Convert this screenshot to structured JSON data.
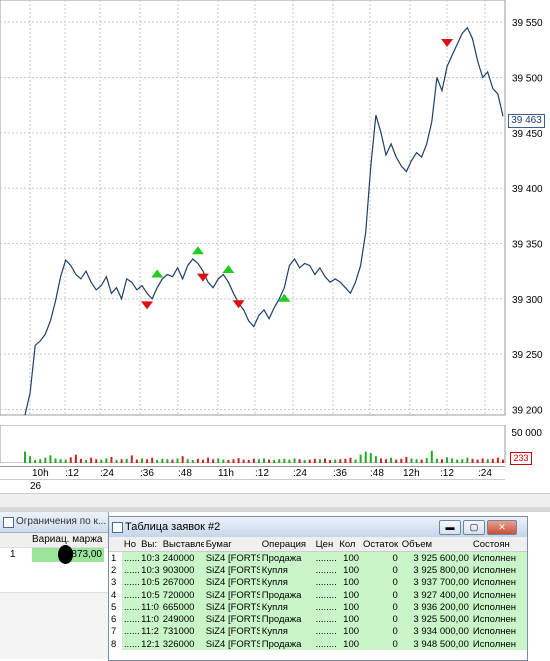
{
  "price_axis": {
    "ticks": [
      "39 550",
      "39 500",
      "39 450",
      "39 400",
      "39 350",
      "39 300",
      "39 250",
      "39 200"
    ],
    "tick_values": [
      39550,
      39500,
      39450,
      39400,
      39350,
      39300,
      39250,
      39200
    ],
    "last_price": "39 463"
  },
  "volume_axis": {
    "tick": "50 000",
    "last_volume": "233"
  },
  "time_axis": {
    "labels": [
      "10h",
      ":12",
      ":24",
      ":36",
      ":48",
      "11h",
      ":12",
      ":24",
      ":36",
      ":48",
      "12h",
      ":12",
      ":24"
    ],
    "date": "26"
  },
  "colors": {
    "price_line": "#1f3f6a",
    "buy_marker": "#22cc22",
    "sell_marker": "#dd1111",
    "volume_up": "#22aa22",
    "volume_down": "#cc2222",
    "grid": "#c8c8c8",
    "row_fill": "#c9f5c9"
  },
  "chart_data": {
    "type": "line",
    "ylim": [
      39195,
      39570
    ],
    "series": [
      {
        "values": [
          39195,
          39215,
          39258,
          39262,
          39268,
          39280,
          39298,
          39320,
          39335,
          39330,
          39322,
          39318,
          39325,
          39315,
          39308,
          39312,
          39320,
          39305,
          39310,
          39300,
          39318,
          39315,
          39308,
          39312,
          39305,
          39300,
          39310,
          39318,
          39322,
          39320,
          39328,
          39318,
          39330,
          39336,
          39332,
          39325,
          39315,
          39310,
          39318,
          39322,
          39315,
          39305,
          39296,
          39290,
          39280,
          39275,
          39285,
          39290,
          39282,
          39292,
          39300,
          39310,
          39330,
          39336,
          39328,
          39332,
          39330,
          39322,
          39328,
          39320,
          39315,
          39318,
          39315,
          39310,
          39305,
          39315,
          39330,
          39360,
          39420,
          39466,
          39450,
          39430,
          39440,
          39428,
          39420,
          39415,
          39425,
          39432,
          39428,
          39440,
          39460,
          39500,
          39488,
          39510,
          39520,
          39530,
          39540,
          39545,
          39535,
          39515,
          39500,
          39505,
          39490,
          39485,
          39465
        ]
      }
    ],
    "markers": [
      {
        "type": "sell",
        "index": 24,
        "value": 39295
      },
      {
        "type": "buy",
        "index": 26,
        "value": 39322
      },
      {
        "type": "buy",
        "index": 34,
        "value": 39343
      },
      {
        "type": "sell",
        "index": 35,
        "value": 39320
      },
      {
        "type": "buy",
        "index": 40,
        "value": 39326
      },
      {
        "type": "sell",
        "index": 42,
        "value": 39296
      },
      {
        "type": "buy",
        "index": 51,
        "value": 39300
      },
      {
        "type": "sell",
        "index": 83,
        "value": 39532
      }
    ],
    "volume": [
      30,
      18,
      8,
      10,
      14,
      20,
      12,
      10,
      9,
      15,
      22,
      11,
      8,
      14,
      10,
      9,
      12,
      16,
      8,
      10,
      11,
      20,
      9,
      12,
      10,
      14,
      8,
      11,
      10,
      9,
      12,
      18,
      10,
      8,
      11,
      9,
      14,
      10,
      12,
      9,
      8,
      10,
      13,
      9,
      8,
      11,
      10,
      12,
      9,
      8,
      10,
      11,
      9,
      12,
      10,
      8,
      9,
      11,
      10,
      12,
      8,
      9,
      10,
      11,
      14,
      9,
      22,
      30,
      26,
      18,
      12,
      10,
      14,
      9,
      11,
      16,
      12,
      10,
      9,
      13,
      32,
      11,
      10,
      15,
      12,
      9,
      10,
      14,
      11,
      9,
      12,
      10,
      11,
      14,
      9
    ],
    "volume_ylim": [
      0,
      60000
    ]
  },
  "limits_panel": {
    "title": "Ограничения по к...",
    "header": "Вариац. маржа",
    "row_index": "1",
    "value": "873,00"
  },
  "orders_window": {
    "title": "Таблица заявок #2",
    "buttons": {
      "minimize": "▬",
      "maximize": "▢",
      "close": "✕"
    },
    "columns": [
      "",
      "Но",
      "Вы:",
      "Выставлен",
      "Бумаг",
      "Операция",
      "Цен",
      "Кол",
      "Остаток",
      "Объем",
      "Состоян"
    ],
    "rows": [
      [
        "1",
        "......",
        "10:3",
        "240000",
        "SiZ4 [FORTS]",
        "Продажа",
        "........",
        "100",
        "0",
        "3 925 600,00",
        "Исполнен"
      ],
      [
        "2",
        "......",
        "10:3",
        "903000",
        "SiZ4 [FORTS]",
        "Купля",
        "........",
        "100",
        "0",
        "3 925 800,00",
        "Исполнен"
      ],
      [
        "3",
        "......",
        "10:5",
        "267000",
        "SiZ4 [FORTS]",
        "Купля",
        "........",
        "100",
        "0",
        "3 937 700,00",
        "Исполнен"
      ],
      [
        "4",
        "......",
        "10:5",
        "720000",
        "SiZ4 [FORTS]",
        "Продажа",
        "........",
        "100",
        "0",
        "3 927 400,00",
        "Исполнен"
      ],
      [
        "5",
        "......",
        "11:0",
        "665000",
        "SiZ4 [FORTS]",
        "Купля",
        "........",
        "100",
        "0",
        "3 936 200,00",
        "Исполнен"
      ],
      [
        "6",
        "......",
        "11:0",
        "249000",
        "SiZ4 [FORTS]",
        "Продажа",
        "........",
        "100",
        "0",
        "3 925 500,00",
        "Исполнен"
      ],
      [
        "7",
        "......",
        "11:2",
        "731000",
        "SiZ4 [FORTS]",
        "Купля",
        "........",
        "100",
        "0",
        "3 934 000,00",
        "Исполнен"
      ],
      [
        "8",
        "......",
        "12:1",
        "326000",
        "SiZ4 [FORTS]",
        "Продажа",
        "........",
        "100",
        "0",
        "3 948 500,00",
        "Исполнен"
      ]
    ]
  }
}
